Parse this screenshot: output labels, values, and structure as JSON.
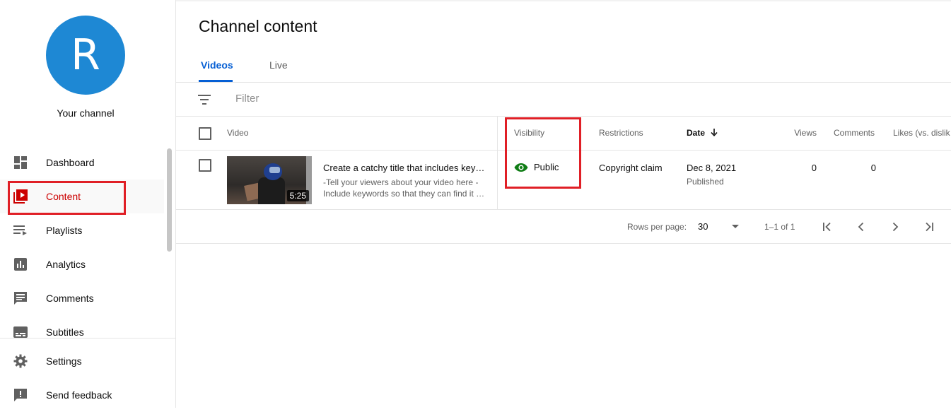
{
  "sidebar": {
    "avatar_letter": "R",
    "avatar_color": "#1e88d4",
    "channel_label": "Your channel",
    "items": [
      {
        "label": "Dashboard",
        "icon": "dashboard-icon"
      },
      {
        "label": "Content",
        "icon": "content-icon",
        "active": true
      },
      {
        "label": "Playlists",
        "icon": "playlists-icon"
      },
      {
        "label": "Analytics",
        "icon": "analytics-icon"
      },
      {
        "label": "Comments",
        "icon": "comments-icon"
      },
      {
        "label": "Subtitles",
        "icon": "subtitles-icon"
      }
    ],
    "bottom_items": [
      {
        "label": "Settings",
        "icon": "gear-icon"
      },
      {
        "label": "Send feedback",
        "icon": "feedback-icon"
      }
    ]
  },
  "main": {
    "title": "Channel content",
    "tabs": [
      {
        "label": "Videos",
        "active": true
      },
      {
        "label": "Live",
        "active": false
      }
    ],
    "filter_placeholder": "Filter",
    "columns": {
      "video": "Video",
      "visibility": "Visibility",
      "restrictions": "Restrictions",
      "date": "Date",
      "views": "Views",
      "comments": "Comments",
      "likes": "Likes (vs. dislik"
    },
    "rows": [
      {
        "duration": "5:25",
        "title": "Create a catchy title that includes keywords",
        "description_line1": "-Tell your viewers about your video here -",
        "description_line2": "Include keywords so that they can find it easily",
        "visibility": "Public",
        "restrictions": "Copyright claim",
        "date": "Dec 8, 2021",
        "date_status": "Published",
        "views": "0",
        "comments": "0"
      }
    ],
    "pagination": {
      "rows_per_page_label": "Rows per page:",
      "rows_per_page": "30",
      "range": "1–1 of 1"
    }
  },
  "colors": {
    "accent_blue": "#065fd4",
    "active_red": "#cc0000",
    "public_green": "#0f7d15",
    "highlight_box": "#e01f26"
  }
}
